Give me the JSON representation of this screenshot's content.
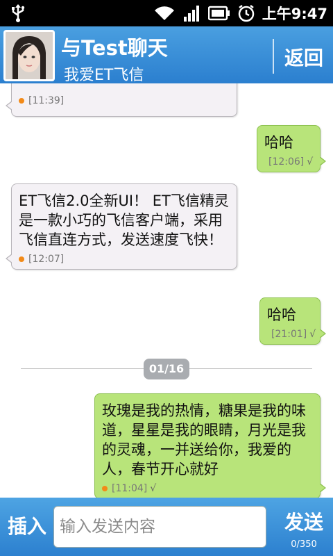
{
  "status_bar": {
    "time": "上午9:47",
    "icons": [
      "usb-icon",
      "wifi-icon",
      "signal-icon",
      "battery-icon",
      "alarm-icon"
    ]
  },
  "header": {
    "title": "与Test聊天",
    "subtitle": "我爱ET飞信",
    "back_label": "返回"
  },
  "messages": [
    {
      "direction": "in",
      "text": "",
      "time": "[11:39]"
    },
    {
      "direction": "out",
      "text": "哈哈",
      "time": "[12:06]",
      "status": "√"
    },
    {
      "direction": "in",
      "text": "ET飞信2.0全新UI！ ET飞信精灵是一款小巧的飞信客户端，采用飞信直连方式，发送速度飞快！",
      "time": "[12:07]"
    },
    {
      "direction": "out",
      "text": "哈哈",
      "time": "[21:01]",
      "status": "√"
    },
    {
      "direction": "out",
      "text": "玫瑰是我的热情，糖果是我的味道，星星是我的眼睛，月光是我的灵魂，一并送给你，我爱的人，春节开心就好",
      "time": "[11:04]",
      "status": "√"
    }
  ],
  "date_separator": "01/16",
  "input_bar": {
    "insert_label": "插入",
    "placeholder": "输入发送内容",
    "value": "",
    "send_label": "发送",
    "counter": "0/350"
  },
  "colors": {
    "header_blue": "#2b7fcf",
    "incoming_bubble": "#f4f1f5",
    "outgoing_bubble": "#b8e47a",
    "status_dot": "#f28a18"
  }
}
